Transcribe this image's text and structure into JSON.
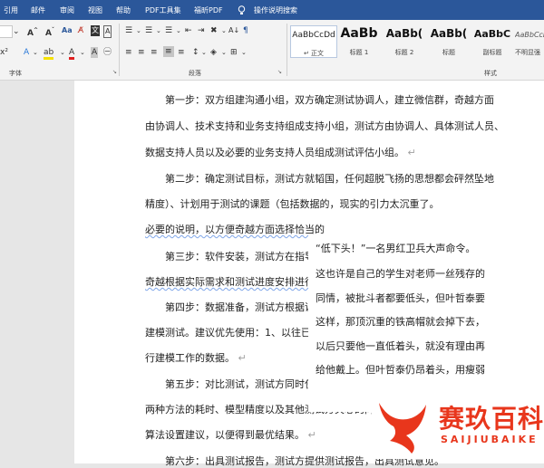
{
  "menubar": {
    "items": [
      "引用",
      "邮件",
      "审阅",
      "视图",
      "帮助",
      "PDF工具集",
      "福昕PDF"
    ],
    "search": "操作说明搜索"
  },
  "ribbon": {
    "groups": {
      "font": "字体",
      "paragraph": "段落",
      "styles": "样式"
    },
    "styles": [
      {
        "preview": "AaBbCcDd",
        "name": "↵ 正文"
      },
      {
        "preview": "AaBb",
        "name": "标题 1"
      },
      {
        "preview": "AaBb(",
        "name": "标题 2"
      },
      {
        "preview": "AaBb(",
        "name": "标题"
      },
      {
        "preview": "AaBbC",
        "name": "副标题"
      },
      {
        "preview": "AaBbCcDd",
        "name": "不明显强"
      }
    ]
  },
  "document": {
    "lines": [
      "第一步：双方组建沟通小组，双方确定测试协调人，建立微信群，奇越方面",
      "由协调人、技术支持和业务支持组成支持小组，测试方由协调人、具体测试人员、",
      "数据支持人员以及必要的业务支持人员组成测试评估小组。",
      "第二步：确定测试目标，测试方就韬国，任何超脱飞扬的思想都会砰然坠地",
      "精度）、计划用于测试的课题（包括数据的，现实的引力太沉重了。",
      "必要的说明，以方便奇越方面选择恰当的",
      "第三步：软件安装，测试方在指导下",
      "奇越根据实际需求和测试进度安排进行",
      "第四步：数据准备，测试方根据课题",
      "建模测试。建议优先使用：1、以往已经",
      "行建模工作的数据。",
      "第五步：对比测试，测试方同时使用",
      "两种方法的耗时、模型精度以及其他测试方关心的问",
      "算法设置建议，以便得到最优结果。",
      "第六步：出具测试报告，测试方提供测试报告，出具测试意见。"
    ],
    "overlay_lines": [
      "“低下头！”一名男红卫兵大声命令。",
      "这也许是自己的学生对老师一丝残存的",
      "同情，被批斗者都要低头，但叶哲泰要",
      "这样，那顶沉重的铁高帽就会掉下去，",
      "以后只要他一直低着头，就没有理由再",
      "给他戴上。但叶哲泰仍昂着头，用瘦弱"
    ]
  },
  "watermark": {
    "cn": "赛玖百科",
    "en": "SAIJIUBAIKE"
  },
  "colors": {
    "ribbon_blue": "#2b579a",
    "brand_red": "#e8361c"
  }
}
